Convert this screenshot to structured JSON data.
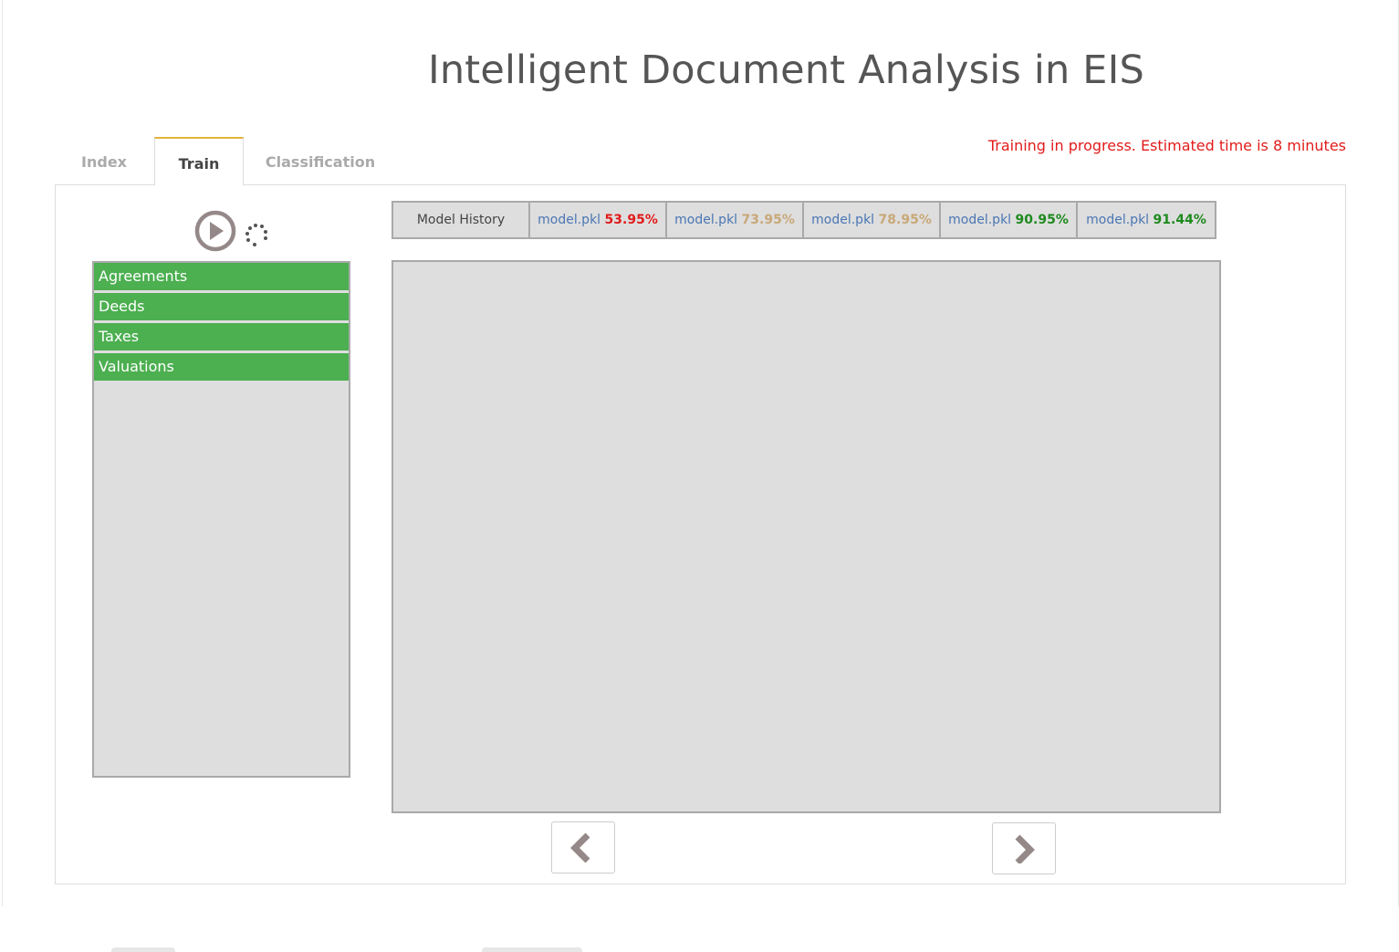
{
  "header": {
    "title": "Intelligent Document Analysis in EIS",
    "status_message": "Training in progress. Estimated time is 8 minutes"
  },
  "colors": {
    "accent_tab": "#e3b23a",
    "category_green": "#4caf50",
    "status_red": "#e21b1b",
    "link_blue": "#4a76b4",
    "pct_low": "#e21b1b",
    "pct_mid": "#c8a878",
    "pct_high": "#1e8a1e"
  },
  "tabs": [
    {
      "label": "Index",
      "active": false
    },
    {
      "label": "Train",
      "active": true
    },
    {
      "label": "Classification",
      "active": false
    }
  ],
  "controls": {
    "play_icon": "play-circle-icon",
    "spinner_icon": "loading-spinner-icon"
  },
  "categories": [
    {
      "label": "Agreements"
    },
    {
      "label": "Deeds"
    },
    {
      "label": "Taxes"
    },
    {
      "label": "Valuations"
    }
  ],
  "model_history": {
    "label": "Model History",
    "models": [
      {
        "name": "model.pkl",
        "accuracy": "53.95%",
        "level": "low"
      },
      {
        "name": "model.pkl",
        "accuracy": "73.95%",
        "level": "mid"
      },
      {
        "name": "model.pkl",
        "accuracy": "78.95%",
        "level": "mid"
      },
      {
        "name": "model.pkl",
        "accuracy": "90.95%",
        "level": "high"
      },
      {
        "name": "model.pkl",
        "accuracy": "91.44%",
        "level": "high"
      }
    ]
  },
  "navigation": {
    "prev_icon": "chevron-left-icon",
    "next_icon": "chevron-right-icon"
  }
}
